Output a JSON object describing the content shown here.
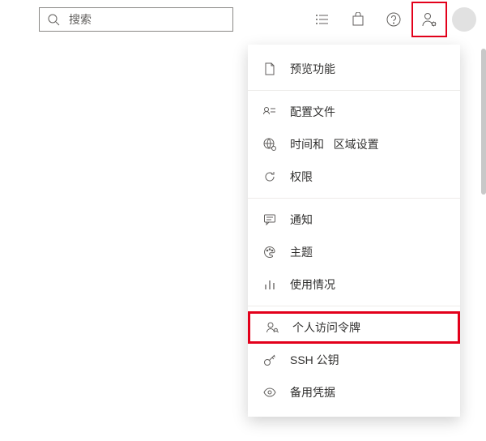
{
  "search": {
    "placeholder": "搜索"
  },
  "menu": {
    "preview": "预览功能",
    "profile": "配置文件",
    "time_region_a": "时间和",
    "time_region_b": "区域设置",
    "permissions": "权限",
    "notifications": "通知",
    "theme": "主题",
    "usage": "使用情况",
    "pat": "个人访问令牌",
    "ssh": "SSH 公钥",
    "alt_creds": "备用凭据"
  }
}
